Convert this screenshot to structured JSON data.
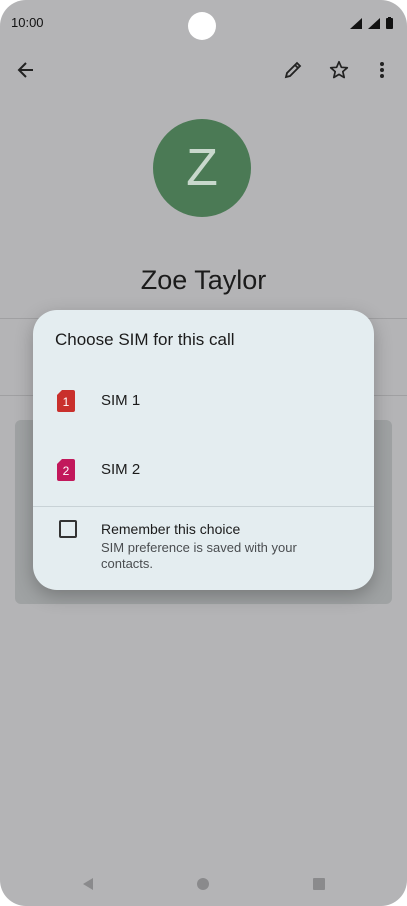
{
  "status_bar": {
    "time": "10:00",
    "icons": [
      "wifi-icon",
      "signal-icon",
      "battery-icon"
    ]
  },
  "app_bar": {
    "icons": [
      "back-arrow-icon",
      "edit-pencil-icon",
      "star-outline-icon",
      "more-vert-icon"
    ]
  },
  "contact": {
    "initial": "Z",
    "name": "Zoe Taylor",
    "avatar_color": "#4b7a55"
  },
  "dialog": {
    "title": "Choose SIM for this call",
    "sims": [
      {
        "badge": "1",
        "label": "SIM 1",
        "color": "#c9302c"
      },
      {
        "badge": "2",
        "label": "SIM 2",
        "color": "#c2185b"
      }
    ],
    "remember": {
      "checked": false,
      "title": "Remember this choice",
      "subtitle": "SIM preference is saved with your contacts."
    }
  },
  "nav_bar": {
    "icons": [
      "back-triangle-icon",
      "home-circle-icon",
      "recents-square-icon"
    ]
  }
}
